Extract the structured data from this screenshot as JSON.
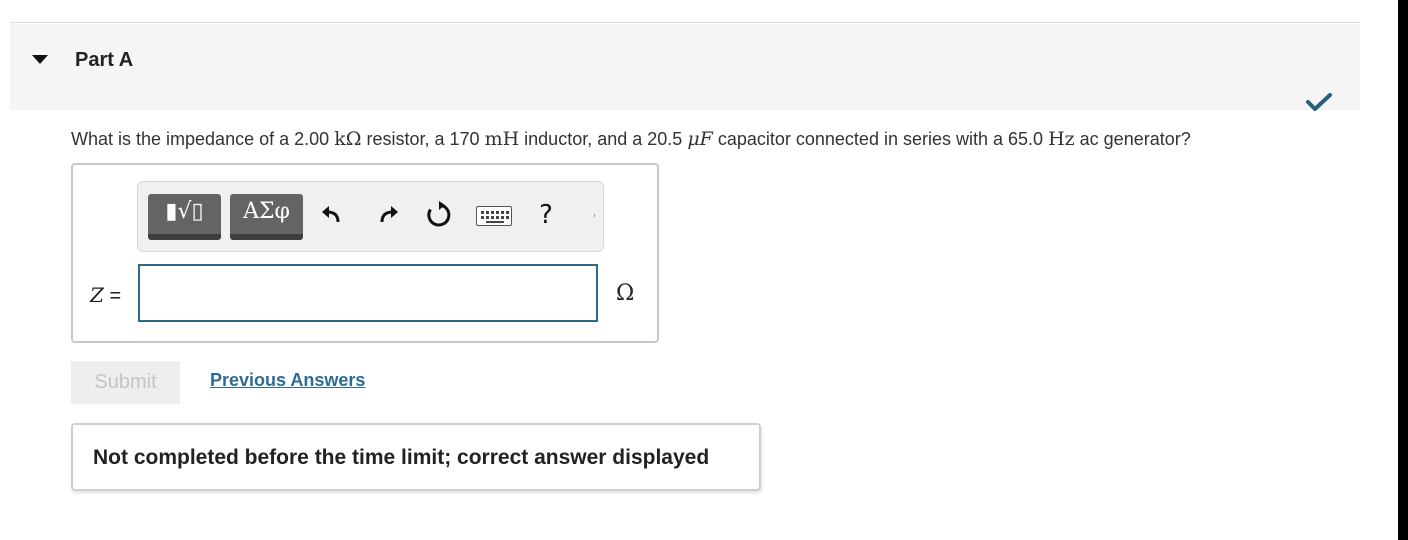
{
  "part": {
    "title": "Part A",
    "status": "correct-check-icon"
  },
  "question": {
    "t1": "What is the impedance of a ",
    "resistance_value": "2.00",
    "resistance_unit": "kΩ",
    "t2": " resistor, a ",
    "inductance_value": "170",
    "inductance_unit": "mH",
    "t3": " inductor, and a ",
    "capacitance_value": "20.5",
    "capacitance_unit": "μF",
    "t4": " capacitor connected in series with a ",
    "frequency_value": "65.0",
    "frequency_unit": "Hz",
    "t5": " ac generator?"
  },
  "toolbar": {
    "templates_glyph": "▮√▯",
    "symbols_glyph": "ΑΣφ",
    "undo_icon": "undo-icon",
    "redo_icon": "redo-icon",
    "reset_icon": "reset-icon",
    "keyboard_icon": "keyboard-icon",
    "help_label": "?"
  },
  "answer": {
    "variable": "Z",
    "equals": "=",
    "value": "",
    "unit": "Ω"
  },
  "actions": {
    "submit_label": "Submit",
    "previous_answers_label": "Previous Answers"
  },
  "feedback": {
    "message": "Not completed before the time limit; correct answer displayed"
  },
  "colors": {
    "link": "#2e6b94",
    "input_border": "#2b6a8a",
    "check": "#2a5f7a",
    "toolbar_button": "#646464"
  }
}
